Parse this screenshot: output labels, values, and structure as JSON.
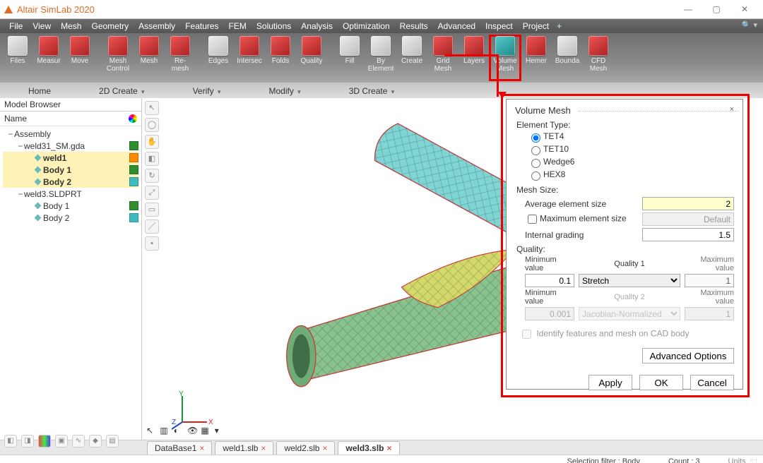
{
  "app": {
    "title": "Altair SimLab 2020"
  },
  "window": {
    "min": "—",
    "max": "▢",
    "close": "✕"
  },
  "menubar": [
    "File",
    "View",
    "Mesh",
    "Geometry",
    "Assembly",
    "Features",
    "FEM",
    "Solutions",
    "Analysis",
    "Optimization",
    "Results",
    "Advanced",
    "Inspect",
    "Project"
  ],
  "ribbon": [
    {
      "label": "Files",
      "name": "tool-files",
      "variant": "light"
    },
    {
      "label": "Measur",
      "name": "tool-measure"
    },
    {
      "label": "Move",
      "name": "tool-move",
      "sep": true
    },
    {
      "label": "Mesh Control",
      "name": "tool-mesh-control"
    },
    {
      "label": "Mesh",
      "name": "tool-mesh"
    },
    {
      "label": "Re- mesh",
      "name": "tool-remesh",
      "sep": true
    },
    {
      "label": "Edges",
      "name": "tool-edges",
      "variant": "light"
    },
    {
      "label": "Intersec",
      "name": "tool-intersec"
    },
    {
      "label": "Folds",
      "name": "tool-folds"
    },
    {
      "label": "Quality",
      "name": "tool-quality",
      "sep": true
    },
    {
      "label": "Fill",
      "name": "tool-fill",
      "variant": "light"
    },
    {
      "label": "By Element",
      "name": "tool-by-element",
      "variant": "light"
    },
    {
      "label": "Create",
      "name": "tool-create",
      "variant": "light"
    },
    {
      "label": "Grid Mesh",
      "name": "tool-grid-mesh"
    },
    {
      "label": "Layers",
      "name": "tool-layers"
    },
    {
      "label": "Volume Mesh",
      "name": "tool-volume-mesh",
      "variant": "teal",
      "highlight": true
    },
    {
      "label": "Hemer",
      "name": "tool-hemer"
    },
    {
      "label": "Bounda",
      "name": "tool-boundary",
      "variant": "light"
    },
    {
      "label": "CFD Mesh",
      "name": "tool-cfd-mesh"
    }
  ],
  "section_tabs": [
    "Home",
    "2D Create",
    "Verify",
    "Modify",
    "3D Create"
  ],
  "model_browser": {
    "title": "Model Browser",
    "name_col": "Name",
    "tree": [
      {
        "d": 0,
        "tw": "−",
        "nm": "Assembly",
        "name": "tree-assembly"
      },
      {
        "d": 1,
        "tw": "−",
        "nm": "weld31_SM.gda",
        "sw": "#2f8f2f",
        "name": "tree-weld31"
      },
      {
        "d": 2,
        "tw": "",
        "nm": "weld1",
        "sw": "#ff8a00",
        "sel": true,
        "diamond": true,
        "name": "tree-weld1"
      },
      {
        "d": 2,
        "tw": "",
        "nm": "Body 1",
        "sw": "#2f8f2f",
        "sel": true,
        "diamond": true,
        "name": "tree-body1a"
      },
      {
        "d": 2,
        "tw": "",
        "nm": "Body 2",
        "sw": "#3fbabf",
        "sel": true,
        "diamond": true,
        "name": "tree-body2a"
      },
      {
        "d": 1,
        "tw": "−",
        "nm": "weld3.SLDPRT",
        "name": "tree-weld3"
      },
      {
        "d": 2,
        "tw": "",
        "nm": "Body 1",
        "sw": "#2f8f2f",
        "diamond": true,
        "name": "tree-body1b"
      },
      {
        "d": 2,
        "tw": "",
        "nm": "Body 2",
        "sw": "#3fbabf",
        "diamond": true,
        "name": "tree-body2b"
      }
    ]
  },
  "triad": {
    "x": "X",
    "y": "Y",
    "z": "Z"
  },
  "file_tabs": [
    {
      "label": "DataBase1",
      "close": "×",
      "active": false
    },
    {
      "label": "weld1.slb",
      "close": "×",
      "active": false
    },
    {
      "label": "weld2.slb",
      "close": "×",
      "active": false
    },
    {
      "label": "weld3.slb",
      "close": "×",
      "active": true
    }
  ],
  "status": {
    "filter": "Selection filter : Body",
    "count": "Count : 3",
    "units": "Units"
  },
  "dialog": {
    "title": "Volume Mesh",
    "element_type": {
      "heading": "Element Type:",
      "options": [
        "TET4",
        "TET10",
        "Wedge6",
        "HEX8"
      ],
      "selected": "TET4"
    },
    "mesh_size": {
      "heading": "Mesh Size:",
      "avg_label": "Average element size",
      "avg_value": "2",
      "max_label": "Maximum element size",
      "max_value": "Default",
      "grad_label": "Internal grading",
      "grad_value": "1.5"
    },
    "quality": {
      "heading": "Quality:",
      "min_label": "Minimum value",
      "q1_label": "Quality 1",
      "max_label": "Maximum value",
      "min1": "0.1",
      "sel1": "Stretch",
      "max1": "1",
      "min2_label": "Minimum value",
      "q2_label": "Quality 2",
      "max2_label": "Maximum value",
      "min2": "0.001",
      "sel2": "Jacobian-Normalized",
      "max2": "1"
    },
    "identify": "Identify features and mesh on CAD body",
    "advanced": "Advanced Options",
    "apply": "Apply",
    "ok": "OK",
    "cancel": "Cancel"
  }
}
